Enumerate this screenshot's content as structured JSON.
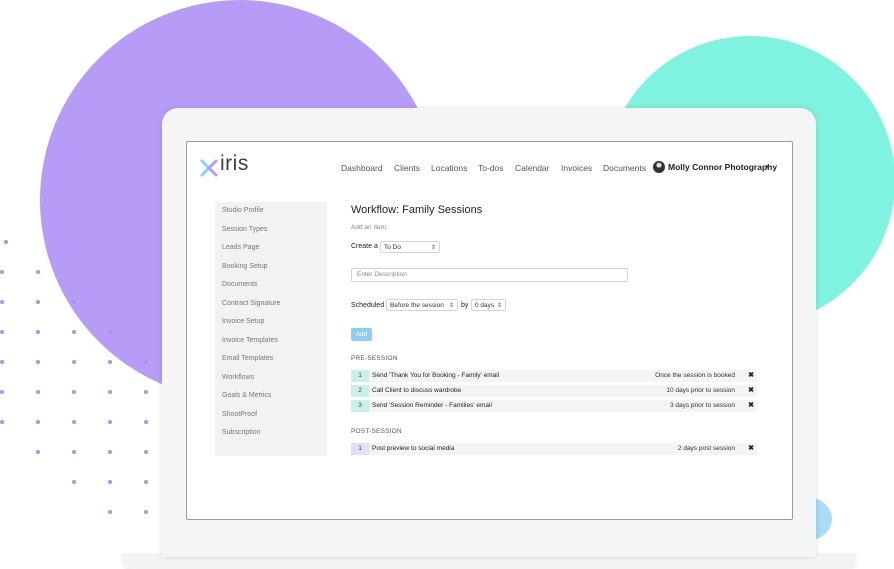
{
  "brand": {
    "name": "iris",
    "accent_teal": "#7ff3df",
    "accent_purple": "#b79cf7"
  },
  "nav": {
    "links": [
      "Dashboard",
      "Clients",
      "Locations",
      "To-dos",
      "Calendar",
      "Invoices",
      "Documents"
    ],
    "user": {
      "name": "Molly Connor Photography",
      "caret": "▾"
    }
  },
  "sidebar": {
    "items": [
      {
        "label": "Studio Profile"
      },
      {
        "label": "Session Types"
      },
      {
        "label": "Leads Page"
      },
      {
        "label": "Booking Setup"
      },
      {
        "label": "Documents"
      },
      {
        "label": "Contract Signature"
      },
      {
        "label": "Invoice Setup"
      },
      {
        "label": "Invoice Templates"
      },
      {
        "label": "Email Templates"
      },
      {
        "label": "Workflows"
      },
      {
        "label": "Goals & Metrics"
      },
      {
        "label": "ShootProof"
      },
      {
        "label": "Subscription"
      }
    ]
  },
  "workflow": {
    "title": "Workflow: Family Sessions",
    "add_item_label": "Add an Item:",
    "create_label": "Create a",
    "create_value": "To Do",
    "description_placeholder": "Enter Description",
    "scheduled_label": "Scheduled",
    "scheduled_value": "Before the session",
    "by_label": "by",
    "days_value": "0 days",
    "add_button": "Add",
    "remove_icon": "✖",
    "pre_session": {
      "label": "PRE-SESSION",
      "items": [
        {
          "num": "1",
          "text": "Send 'Thank You for Booking - Family' email",
          "when": "Once the session is booked"
        },
        {
          "num": "2",
          "text": "Call Client to discuss wardrobe",
          "when": "10 days prior to session"
        },
        {
          "num": "3",
          "text": "Send 'Session Reminder - Families' email",
          "when": "3 days prior to session"
        }
      ]
    },
    "post_session": {
      "label": "POST-SESSION",
      "items": [
        {
          "num": "1",
          "text": "Post preview to social media",
          "when": "2 days post session"
        }
      ]
    }
  }
}
